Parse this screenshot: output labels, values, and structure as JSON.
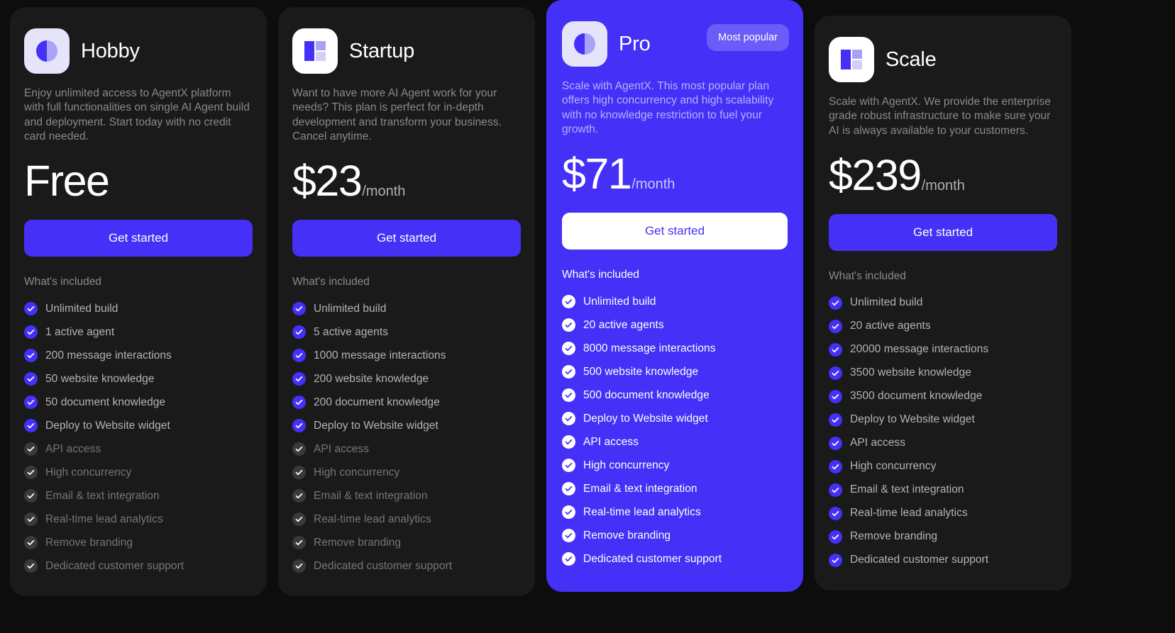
{
  "colors": {
    "page_bg": "#0d0d0d",
    "card_bg": "#1a1a1a",
    "accent": "#4430f7",
    "badge_bg": "#6b5cf8",
    "icon_tint_lavender": "#e6e4fb",
    "icon_tint_white": "#ffffff",
    "check_on": "#4430f7",
    "check_off": "#3a3a3d"
  },
  "common": {
    "included_label": "What's included",
    "cta_label": "Get started",
    "period": "/month"
  },
  "plans": [
    {
      "id": "hobby",
      "name": "Hobby",
      "icon": "split-circle-icon",
      "icon_tint": "lavender",
      "description": "Enjoy unlimited access to AgentX platform with full functionalities on single AI Agent build and deployment. Start today with no credit card needed.",
      "price": "Free",
      "period": "",
      "featured": false,
      "badge": "",
      "cta_label": "Get started",
      "included_label": "What's included",
      "features": [
        {
          "label": "Unlimited build",
          "enabled": true
        },
        {
          "label": "1 active agent",
          "enabled": true
        },
        {
          "label": "200 message interactions",
          "enabled": true
        },
        {
          "label": "50 website knowledge",
          "enabled": true
        },
        {
          "label": "50 document knowledge",
          "enabled": true
        },
        {
          "label": "Deploy to Website widget",
          "enabled": true
        },
        {
          "label": "API access",
          "enabled": false
        },
        {
          "label": "High concurrency",
          "enabled": false
        },
        {
          "label": "Email & text integration",
          "enabled": false
        },
        {
          "label": "Real-time lead analytics",
          "enabled": false
        },
        {
          "label": "Remove branding",
          "enabled": false
        },
        {
          "label": "Dedicated customer support",
          "enabled": false
        }
      ]
    },
    {
      "id": "startup",
      "name": "Startup",
      "icon": "layout-blocks-icon",
      "icon_tint": "white",
      "description": "Want to have more AI Agent work for your needs? This plan is perfect for in-depth development and transform your business. Cancel anytime.",
      "price": "$23",
      "period": "/month",
      "featured": false,
      "badge": "",
      "cta_label": "Get started",
      "included_label": "What's included",
      "features": [
        {
          "label": "Unlimited build",
          "enabled": true
        },
        {
          "label": "5 active agents",
          "enabled": true
        },
        {
          "label": "1000 message interactions",
          "enabled": true
        },
        {
          "label": "200 website knowledge",
          "enabled": true
        },
        {
          "label": "200 document knowledge",
          "enabled": true
        },
        {
          "label": "Deploy to Website widget",
          "enabled": true
        },
        {
          "label": "API access",
          "enabled": false
        },
        {
          "label": "High concurrency",
          "enabled": false
        },
        {
          "label": "Email & text integration",
          "enabled": false
        },
        {
          "label": "Real-time lead analytics",
          "enabled": false
        },
        {
          "label": "Remove branding",
          "enabled": false
        },
        {
          "label": "Dedicated customer support",
          "enabled": false
        }
      ]
    },
    {
      "id": "pro",
      "name": "Pro",
      "icon": "split-circle-icon",
      "icon_tint": "lavender",
      "description": "Scale with AgentX. This most popular plan offers high concurrency and high scalability with no knowledge restriction to fuel your growth.",
      "price": "$71",
      "period": "/month",
      "featured": true,
      "badge": "Most popular",
      "cta_label": "Get started",
      "included_label": "What's included",
      "features": [
        {
          "label": "Unlimited build",
          "enabled": true
        },
        {
          "label": "20 active agents",
          "enabled": true
        },
        {
          "label": "8000 message interactions",
          "enabled": true
        },
        {
          "label": "500 website knowledge",
          "enabled": true
        },
        {
          "label": "500 document knowledge",
          "enabled": true
        },
        {
          "label": "Deploy to Website widget",
          "enabled": true
        },
        {
          "label": "API access",
          "enabled": true
        },
        {
          "label": "High concurrency",
          "enabled": true
        },
        {
          "label": "Email & text integration",
          "enabled": true
        },
        {
          "label": "Real-time lead analytics",
          "enabled": true
        },
        {
          "label": "Remove branding",
          "enabled": true
        },
        {
          "label": "Dedicated customer support",
          "enabled": true
        }
      ]
    },
    {
      "id": "scale",
      "name": "Scale",
      "icon": "layout-blocks-icon",
      "icon_tint": "white",
      "description": "Scale with AgentX. We provide the enterprise grade robust infrastructure to make sure your AI is always available to your customers.",
      "price": "$239",
      "period": "/month",
      "featured": false,
      "badge": "",
      "cta_label": "Get started",
      "included_label": "What's included",
      "features": [
        {
          "label": "Unlimited build",
          "enabled": true
        },
        {
          "label": "20 active agents",
          "enabled": true
        },
        {
          "label": "20000 message interactions",
          "enabled": true
        },
        {
          "label": "3500 website knowledge",
          "enabled": true
        },
        {
          "label": "3500 document knowledge",
          "enabled": true
        },
        {
          "label": "Deploy to Website widget",
          "enabled": true
        },
        {
          "label": "API access",
          "enabled": true
        },
        {
          "label": "High concurrency",
          "enabled": true
        },
        {
          "label": "Email & text integration",
          "enabled": true
        },
        {
          "label": "Real-time lead analytics",
          "enabled": true
        },
        {
          "label": "Remove branding",
          "enabled": true
        },
        {
          "label": "Dedicated customer support",
          "enabled": true
        }
      ]
    }
  ]
}
